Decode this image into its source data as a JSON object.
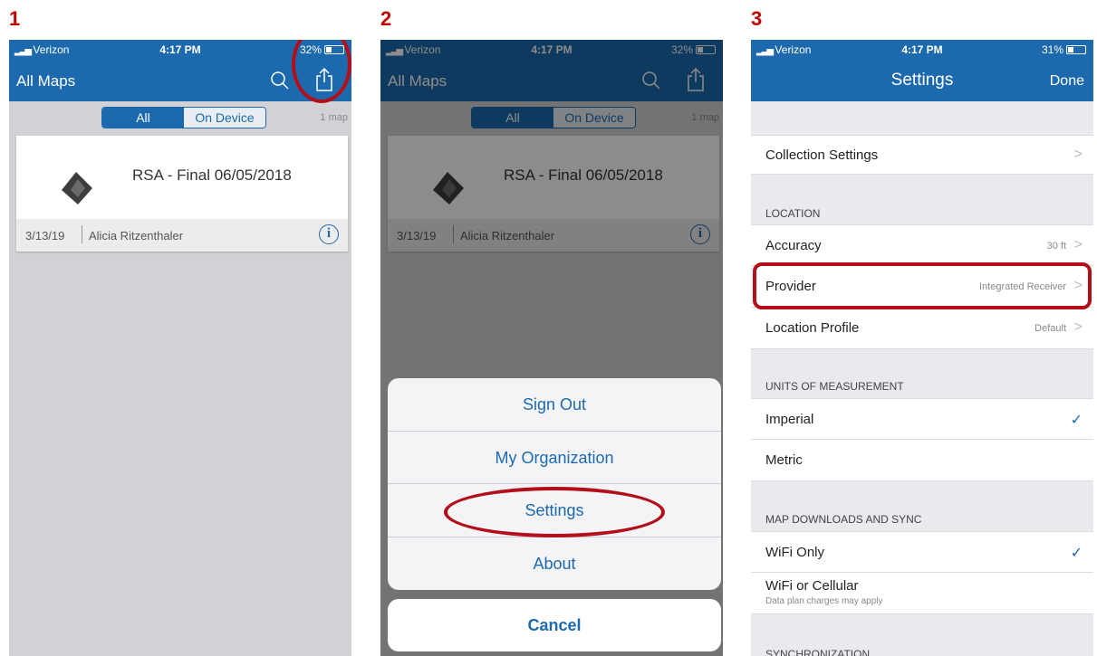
{
  "steps": [
    "1",
    "2",
    "3"
  ],
  "status": {
    "carrier": "Verizon",
    "time": "4:17 PM",
    "battery1": "32%",
    "battery2": "32%",
    "battery3": "31%"
  },
  "maps": {
    "title": "All Maps",
    "seg_all": "All",
    "seg_device": "On Device",
    "count": "1 map",
    "card": {
      "name": "RSA - Final 06/05/2018",
      "date": "3/13/19",
      "author": "Alicia Ritzenthaler"
    }
  },
  "action_sheet": {
    "items": [
      "Sign Out",
      "My Organization",
      "Settings",
      "About"
    ],
    "cancel": "Cancel"
  },
  "settings": {
    "title": "Settings",
    "done": "Done",
    "collection": "Collection Settings",
    "location_header": "LOCATION",
    "accuracy": {
      "label": "Accuracy",
      "value": "30 ft"
    },
    "provider": {
      "label": "Provider",
      "value": "Integrated Receiver"
    },
    "profile": {
      "label": "Location Profile",
      "value": "Default"
    },
    "units_header": "UNITS OF MEASUREMENT",
    "imperial": "Imperial",
    "metric": "Metric",
    "downloads_header": "MAP DOWNLOADS AND SYNC",
    "wifi_only": "WiFi Only",
    "wifi_cell": "WiFi or Cellular",
    "wifi_cell_sub": "Data plan charges may apply",
    "sync_header": "SYNCHRONIZATION"
  },
  "icons": {
    "search": "search-icon",
    "share": "share-icon",
    "info": "info-icon",
    "chevron": "chevron-right-icon",
    "check": "checkmark-icon"
  },
  "colors": {
    "nav_blue": "#1c6aad",
    "highlight_red": "#b30f1a",
    "step_red": "#c00000"
  }
}
